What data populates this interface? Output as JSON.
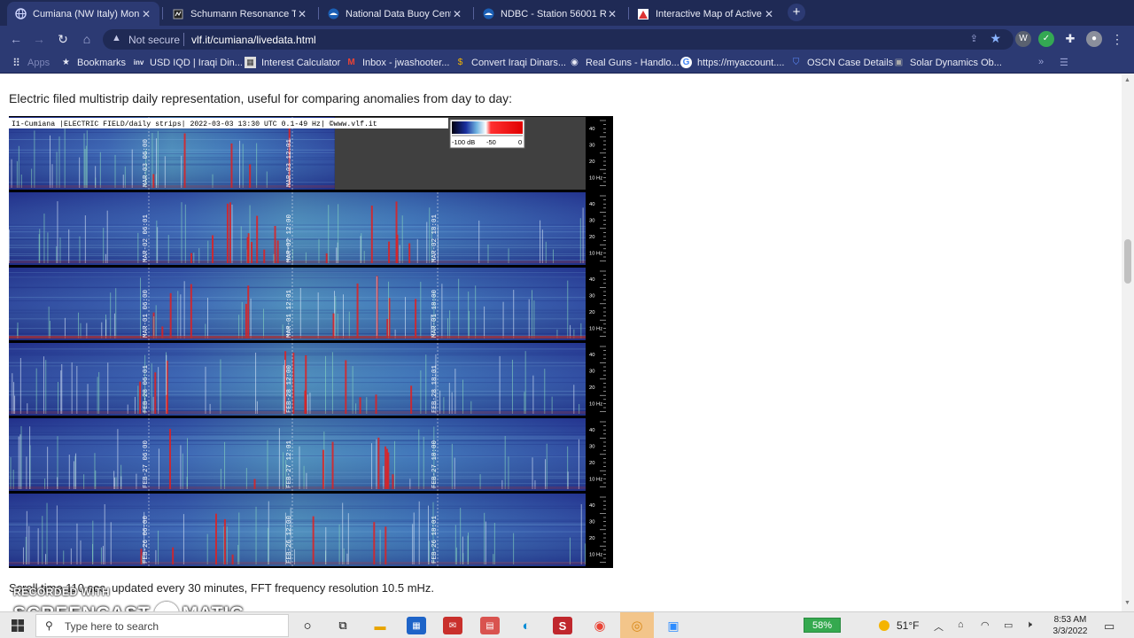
{
  "tabs": [
    {
      "title": "Cumiana (NW Italy) Monito",
      "favicon": "globe-icon",
      "active": true
    },
    {
      "title": "Schumann Resonance Toda",
      "favicon": "page-icon",
      "active": false
    },
    {
      "title": "National Data Buoy Center",
      "favicon": "noaa-icon",
      "active": false
    },
    {
      "title": "NDBC - Station 56001 Rece",
      "favicon": "noaa-icon",
      "active": false
    },
    {
      "title": "Interactive Map of Active V",
      "favicon": "map-icon",
      "active": false
    }
  ],
  "toolbar": {
    "security_label": "Not secure",
    "url": "vlf.it/cumiana/livedata.html"
  },
  "bookmarks": [
    {
      "label": "Bookmarks",
      "icon": "star-icon"
    },
    {
      "label": "USD IQD | Iraqi Din...",
      "icon": "inv-icon"
    },
    {
      "label": "Interest Calculator",
      "icon": "calculator-icon"
    },
    {
      "label": "Inbox - jwashooter...",
      "icon": "gmail-icon"
    },
    {
      "label": "Convert Iraqi Dinars...",
      "icon": "currency-icon"
    },
    {
      "label": "Real Guns - Handlo...",
      "icon": "target-icon"
    },
    {
      "label": "https://myaccount....",
      "icon": "google-icon"
    },
    {
      "label": "OSCN Case Details",
      "icon": "shield-icon"
    },
    {
      "label": "Solar Dynamics Ob...",
      "icon": "sdo-icon"
    }
  ],
  "page": {
    "intro": "Electric filed multistrip daily representation, useful for comparing anomalies from day to day:",
    "footer": "Scroll time 110 sec, updated every 30 minutes, FFT frequency resolution 10.5 mHz."
  },
  "spectrogram": {
    "header": "I1-Cumiana |ELECTRIC FIELD/daily strips| 2022-03-03 13:30 UTC 0.1-49 Hz| ©www.vlf.it",
    "colorbar_labels": [
      "-100 dB",
      "-50",
      "0"
    ],
    "freq_ticks": [
      "40",
      "30",
      "20",
      "10 Hz"
    ],
    "strips": [
      {
        "day": "MAR-03",
        "labels": [
          "MAR-03 06:00",
          "MAR-03 12:01"
        ]
      },
      {
        "day": "MAR-02",
        "labels": [
          "MAR-02 06:01",
          "MAR-02 12:00",
          "MAR-02 18:01"
        ]
      },
      {
        "day": "MAR-01",
        "labels": [
          "MAR-01 06:00",
          "MAR-01 12:01",
          "MAR-01 18:00"
        ]
      },
      {
        "day": "FEB-28",
        "labels": [
          "FEB-28 06:01",
          "FEB-28 12:00",
          "FEB-28 18:01"
        ]
      },
      {
        "day": "FEB-27",
        "labels": [
          "FEB-27 06:00",
          "FEB-27 12:01",
          "FEB-27 18:00"
        ]
      },
      {
        "day": "FEB-26",
        "labels": [
          "FEB-26 06:00",
          "FEB-26 12:00",
          "FEB-26 18:01"
        ]
      }
    ],
    "partial_fraction": 0.565
  },
  "watermark": {
    "line1": "RECORDED WITH",
    "line2a": "SCREENCAST",
    "line2b": "MATIC"
  },
  "taskbar": {
    "search_placeholder": "Type here to search",
    "battery": "58%",
    "temperature": "51°F",
    "time": "8:53 AM",
    "date": "3/3/2022"
  }
}
